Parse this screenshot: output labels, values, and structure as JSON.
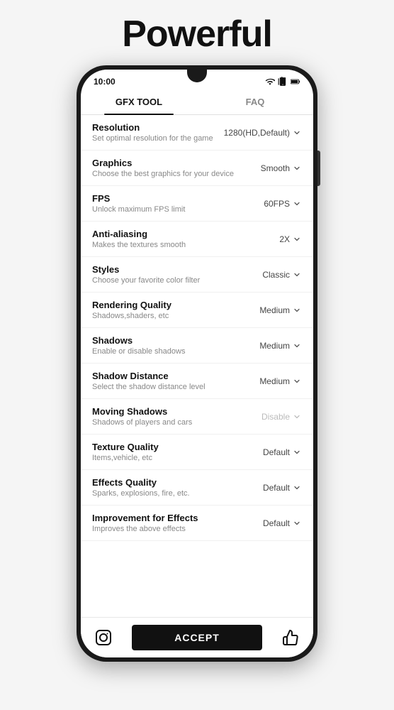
{
  "header": {
    "title": "Powerful"
  },
  "phone": {
    "time": "10:00",
    "tabs": [
      {
        "id": "gfx",
        "label": "GFX TOOL",
        "active": true
      },
      {
        "id": "faq",
        "label": "FAQ",
        "active": false
      }
    ],
    "settings": [
      {
        "id": "resolution",
        "title": "Resolution",
        "desc": "Set optimal resolution for the game",
        "value": "1280(HD,Default)",
        "disabled": false
      },
      {
        "id": "graphics",
        "title": "Graphics",
        "desc": "Choose the best graphics for your device",
        "value": "Smooth",
        "disabled": false
      },
      {
        "id": "fps",
        "title": "FPS",
        "desc": "Unlock maximum FPS limit",
        "value": "60FPS",
        "disabled": false
      },
      {
        "id": "antialiasing",
        "title": "Anti-aliasing",
        "desc": "Makes the textures smooth",
        "value": "2X",
        "disabled": false
      },
      {
        "id": "styles",
        "title": "Styles",
        "desc": "Choose your favorite color filter",
        "value": "Classic",
        "disabled": false
      },
      {
        "id": "rendering",
        "title": "Rendering Quality",
        "desc": "Shadows,shaders, etc",
        "value": "Medium",
        "disabled": false
      },
      {
        "id": "shadows",
        "title": "Shadows",
        "desc": "Enable or disable shadows",
        "value": "Medium",
        "disabled": false
      },
      {
        "id": "shadow-distance",
        "title": "Shadow Distance",
        "desc": "Select the shadow distance level",
        "value": "Medium",
        "disabled": false
      },
      {
        "id": "moving-shadows",
        "title": "Moving Shadows",
        "desc": "Shadows of players and cars",
        "value": "Disable",
        "disabled": true
      },
      {
        "id": "texture-quality",
        "title": "Texture Quality",
        "desc": "Items,vehicle, etc",
        "value": "Default",
        "disabled": false
      },
      {
        "id": "effects-quality",
        "title": "Effects Quality",
        "desc": "Sparks, explosions, fire, etc.",
        "value": "Default",
        "disabled": false
      },
      {
        "id": "improvement-effects",
        "title": "Improvement for Effects",
        "desc": "Improves the above effects",
        "value": "Default",
        "disabled": false
      }
    ],
    "bottomBar": {
      "acceptLabel": "ACCEPT"
    }
  }
}
